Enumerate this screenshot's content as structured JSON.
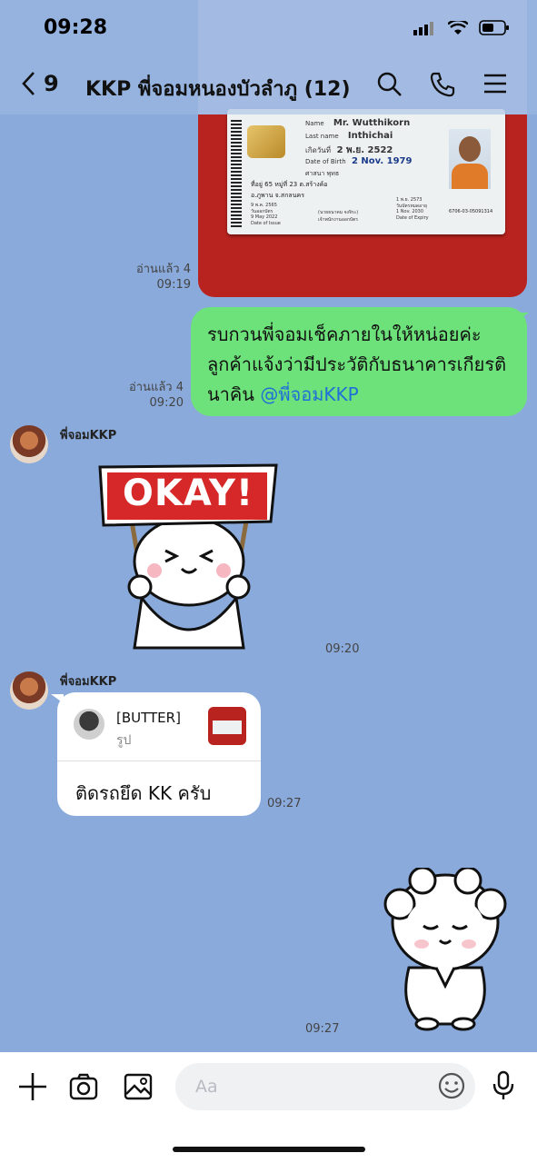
{
  "status": {
    "time": "09:28"
  },
  "header": {
    "unread_count": "9",
    "title": "KKP พี่จอมหนองบัวลำภู (12)"
  },
  "id_card": {
    "name_label": "Name",
    "name": "Mr. Wutthikorn",
    "lastname_label": "Last name",
    "lastname": "Inthichai",
    "dob_th_label": "เกิดวันที่",
    "dob_th": "2 พ.ย. 2522",
    "dob_label": "Date of Birth",
    "dob": "2 Nov. 1979",
    "religion": "ศาสนา พุทธ",
    "address": "ที่อยู่ 65 หมู่ที่ 23 ต.สร้างค้อ",
    "address2": "อ.ภูพาน จ.สกลนคร",
    "issue_th": "9 พ.ค. 2565",
    "issue_label_th": "วันออกบัตร",
    "issue": "9 May 2022",
    "issue_label": "Date of Issue",
    "expiry_th": "1 พ.ย. 2573",
    "expiry_label_th": "วันบัตรหมดอายุ",
    "expiry": "1 Nov. 2030",
    "expiry_label": "Date of Expiry",
    "officer": "(นายธนาคม จงจิระ)",
    "officer_title": "เจ้าพนักงานออกบัตร",
    "serial": "6706-03-05091314"
  },
  "messages": {
    "photo_read": "อ่านแล้ว 4",
    "photo_time": "09:19",
    "text_read": "อ่านแล้ว 4",
    "text_time": "09:20",
    "text_body": "รบกวนพี่จอมเช็คภายในให้หน่อยค่ะ ลูกค้าแจ้งว่ามีประวัติกับธนาคารเกียรตินาคิน ",
    "text_mention": "@พี่จอมKKP",
    "sender1": "พี่จอมKKP",
    "sticker1_text": "OKAY!",
    "sticker1_time": "09:20",
    "sender2": "พี่จอมKKP",
    "reply_name": "[BUTTER]",
    "reply_type": "รูป",
    "reply_text": "ติดรถยึด KK ครับ",
    "reply_time": "09:27",
    "sticker2_time": "09:27"
  },
  "input": {
    "placeholder": "Aa"
  },
  "colors": {
    "chat_bg": "#8aaadb",
    "my_bubble": "#6de27a",
    "mention": "#1f6fd8"
  },
  "icons": [
    "chevron-left-icon",
    "search-icon",
    "phone-icon",
    "menu-icon",
    "plus-icon",
    "camera-icon",
    "image-icon",
    "emoji-icon",
    "mic-icon"
  ]
}
